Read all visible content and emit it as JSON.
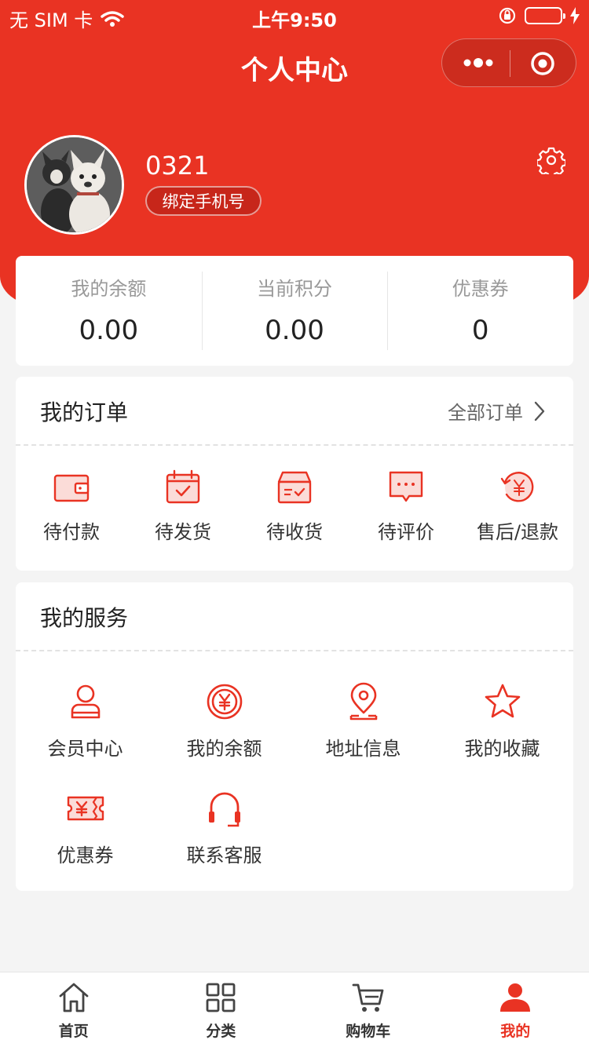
{
  "status_bar": {
    "carrier": "无 SIM 卡",
    "time": "上午9:50"
  },
  "nav": {
    "title": "个人中心"
  },
  "profile": {
    "username": "0321",
    "bind_label": "绑定手机号"
  },
  "stats": [
    {
      "label": "我的余额",
      "value": "0.00"
    },
    {
      "label": "当前积分",
      "value": "0.00"
    },
    {
      "label": "优惠券",
      "value": "0"
    }
  ],
  "orders": {
    "title": "我的订单",
    "all_label": "全部订单",
    "items": [
      {
        "label": "待付款",
        "icon": "wallet-icon"
      },
      {
        "label": "待发货",
        "icon": "calendar-check-icon"
      },
      {
        "label": "待收货",
        "icon": "box-icon"
      },
      {
        "label": "待评价",
        "icon": "chat-bubble-icon"
      },
      {
        "label": "售后/退款",
        "icon": "refund-icon"
      }
    ]
  },
  "services": {
    "title": "我的服务",
    "items": [
      {
        "label": "会员中心",
        "icon": "member-icon"
      },
      {
        "label": "我的余额",
        "icon": "yen-coin-icon"
      },
      {
        "label": "地址信息",
        "icon": "location-pin-icon"
      },
      {
        "label": "我的收藏",
        "icon": "star-icon"
      },
      {
        "label": "优惠券",
        "icon": "coupon-icon"
      },
      {
        "label": "联系客服",
        "icon": "headset-icon"
      }
    ]
  },
  "tabbar": [
    {
      "label": "首页",
      "icon": "home-icon",
      "active": false
    },
    {
      "label": "分类",
      "icon": "grid-icon",
      "active": false
    },
    {
      "label": "购物车",
      "icon": "cart-icon",
      "active": false
    },
    {
      "label": "我的",
      "icon": "user-icon",
      "active": true
    }
  ],
  "colors": {
    "accent": "#e93323",
    "background": "#f4f4f4"
  }
}
